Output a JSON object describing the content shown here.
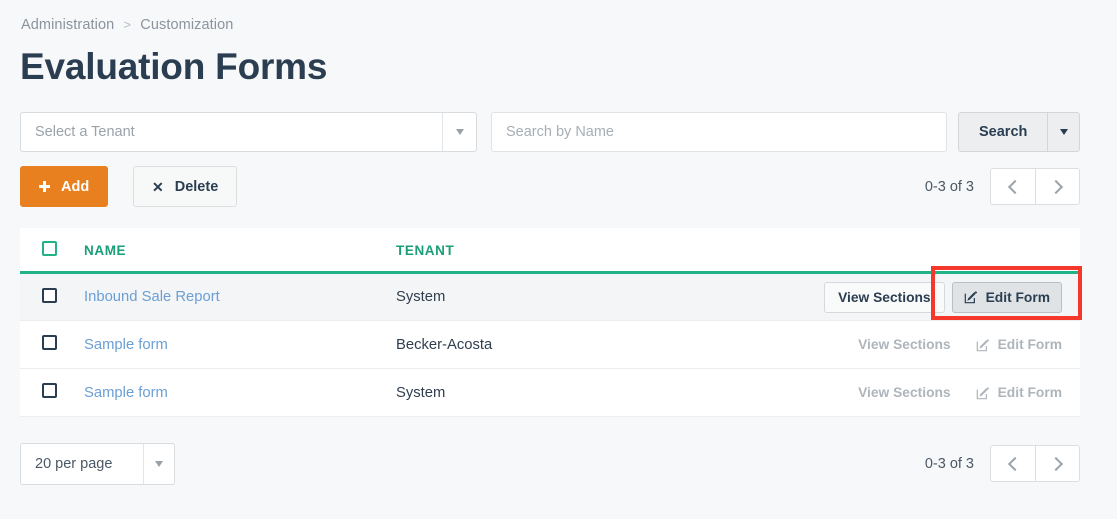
{
  "breadcrumb": {
    "items": [
      "Administration",
      "Customization"
    ],
    "separator": ">"
  },
  "page": {
    "title": "Evaluation Forms"
  },
  "filters": {
    "tenant_select": {
      "value": "Select a Tenant",
      "placeholder": "Select a Tenant"
    },
    "search_field": {
      "value": "",
      "placeholder": "Search by Name"
    },
    "search_button": {
      "label": "Search"
    }
  },
  "toolbar": {
    "add_label": "Add",
    "delete_label": "Delete",
    "add_color": "#e8801f"
  },
  "pagination_top": {
    "range": "0-3 of 3",
    "prev": "‹",
    "next": "›"
  },
  "table": {
    "columns": [
      "",
      "NAME",
      "TENANT",
      ""
    ],
    "header_color": "#1a9e78",
    "rows": [
      {
        "name": "Inbound Sale Report",
        "tenant": "System",
        "view_label": "View Sections",
        "edit_label": "Edit Form",
        "enabled": true,
        "highlighted": true
      },
      {
        "name": "Sample form",
        "tenant": "Becker-Acosta",
        "view_label": "View Sections",
        "edit_label": "Edit Form",
        "enabled": false,
        "highlighted": false
      },
      {
        "name": "Sample form",
        "tenant": "System",
        "view_label": "View Sections",
        "edit_label": "Edit Form",
        "enabled": false,
        "highlighted": false
      }
    ]
  },
  "footer": {
    "per_page": "20 per page",
    "range": "0-3 of 3"
  },
  "annotation": {
    "color": "#f6382c",
    "target": "Edit Form"
  }
}
